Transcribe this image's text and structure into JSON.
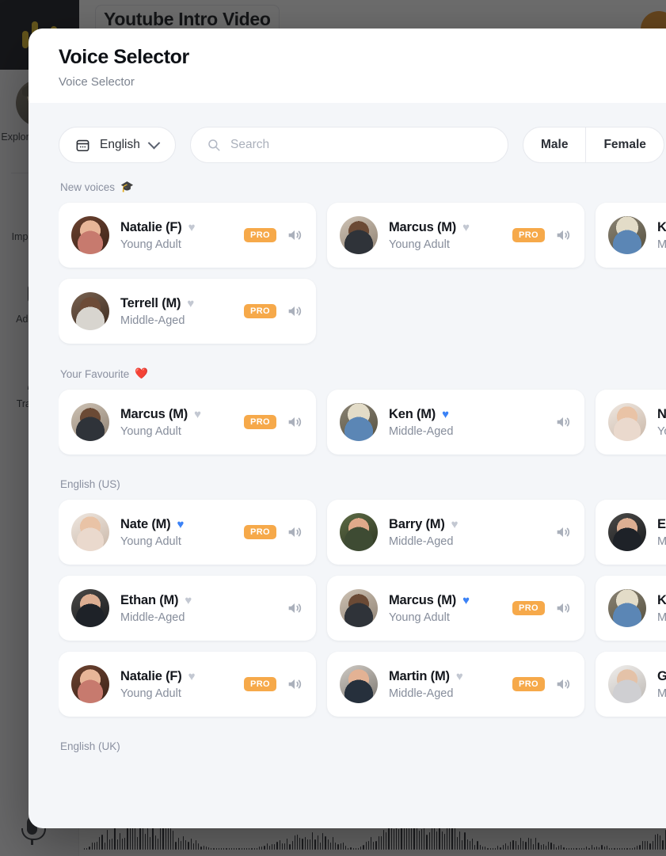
{
  "background_app": {
    "document_title": "Youtube Intro Video",
    "sidebar": [
      {
        "label": "Explore AI Voices",
        "icon": "avatar-icon"
      },
      {
        "label": "Import Script",
        "icon": "document-icon"
      },
      {
        "label": "Add Media",
        "icon": "image-icon"
      },
      {
        "label": "Transcribe",
        "icon": "people-icon"
      }
    ],
    "mic_icon": "microphone-icon",
    "user_avatar": "user-avatar"
  },
  "modal": {
    "title": "Voice Selector",
    "subtitle": "Voice Selector",
    "filters": {
      "language": {
        "value": "English",
        "icon": "calendar-icon",
        "chevron": "chevron-down-icon"
      },
      "search": {
        "value": "",
        "placeholder": "Search",
        "icon": "search-icon"
      },
      "gender": {
        "options": [
          "Male",
          "Female"
        ]
      }
    },
    "colors": {
      "pro_badge": "#f6a94a",
      "favourite_heart": "#3b82f6",
      "plain_heart": "#c3c8d2",
      "modal_background": "#f4f6f9",
      "accent_logo": "#e8c12a"
    },
    "pro_label": "PRO",
    "sections": [
      {
        "title": "New voices",
        "emoji": "🎓",
        "voices": [
          {
            "name": "Natalie (F)",
            "age": "Young Adult",
            "pro": true,
            "favourite": false,
            "avatar": "natalie"
          },
          {
            "name": "Marcus (M)",
            "age": "Young Adult",
            "pro": true,
            "favourite": false,
            "avatar": "marcus"
          },
          {
            "name": "Ken (M)",
            "age": "Middle-Aged",
            "pro": false,
            "favourite": false,
            "avatar": "ken"
          },
          {
            "name": "Terrell (M)",
            "age": "Middle-Aged",
            "pro": true,
            "favourite": false,
            "avatar": "terrell"
          }
        ]
      },
      {
        "title": "Your Favourite",
        "emoji": "❤️",
        "voices": [
          {
            "name": "Marcus (M)",
            "age": "Young Adult",
            "pro": true,
            "favourite": false,
            "avatar": "marcus"
          },
          {
            "name": "Ken (M)",
            "age": "Middle-Aged",
            "pro": false,
            "favourite": true,
            "avatar": "ken"
          },
          {
            "name": "Nate (M)",
            "age": "Young Adult",
            "pro": true,
            "favourite": true,
            "avatar": "nate"
          }
        ]
      },
      {
        "title": "English (US)",
        "emoji": "",
        "voices": [
          {
            "name": "Nate (M)",
            "age": "Young Adult",
            "pro": true,
            "favourite": true,
            "avatar": "nate"
          },
          {
            "name": "Barry (M)",
            "age": "Middle-Aged",
            "pro": false,
            "favourite": false,
            "avatar": "barry"
          },
          {
            "name": "Ethan (M)",
            "age": "Middle-Aged",
            "pro": false,
            "favourite": false,
            "avatar": "ethan"
          },
          {
            "name": "Ethan (M)",
            "age": "Middle-Aged",
            "pro": false,
            "favourite": false,
            "avatar": "ethan"
          },
          {
            "name": "Marcus (M)",
            "age": "Young Adult",
            "pro": true,
            "favourite": true,
            "avatar": "marcus"
          },
          {
            "name": "Ken (M)",
            "age": "Middle-Aged",
            "pro": false,
            "favourite": false,
            "avatar": "ken"
          },
          {
            "name": "Natalie (F)",
            "age": "Young Adult",
            "pro": true,
            "favourite": false,
            "avatar": "natalie"
          },
          {
            "name": "Martin (M)",
            "age": "Middle-Aged",
            "pro": true,
            "favourite": false,
            "avatar": "martin"
          },
          {
            "name": "Gray (M)",
            "age": "Middle-Aged",
            "pro": false,
            "favourite": false,
            "avatar": "gray"
          }
        ]
      },
      {
        "title": "English (UK)",
        "emoji": "",
        "voices": []
      }
    ]
  }
}
